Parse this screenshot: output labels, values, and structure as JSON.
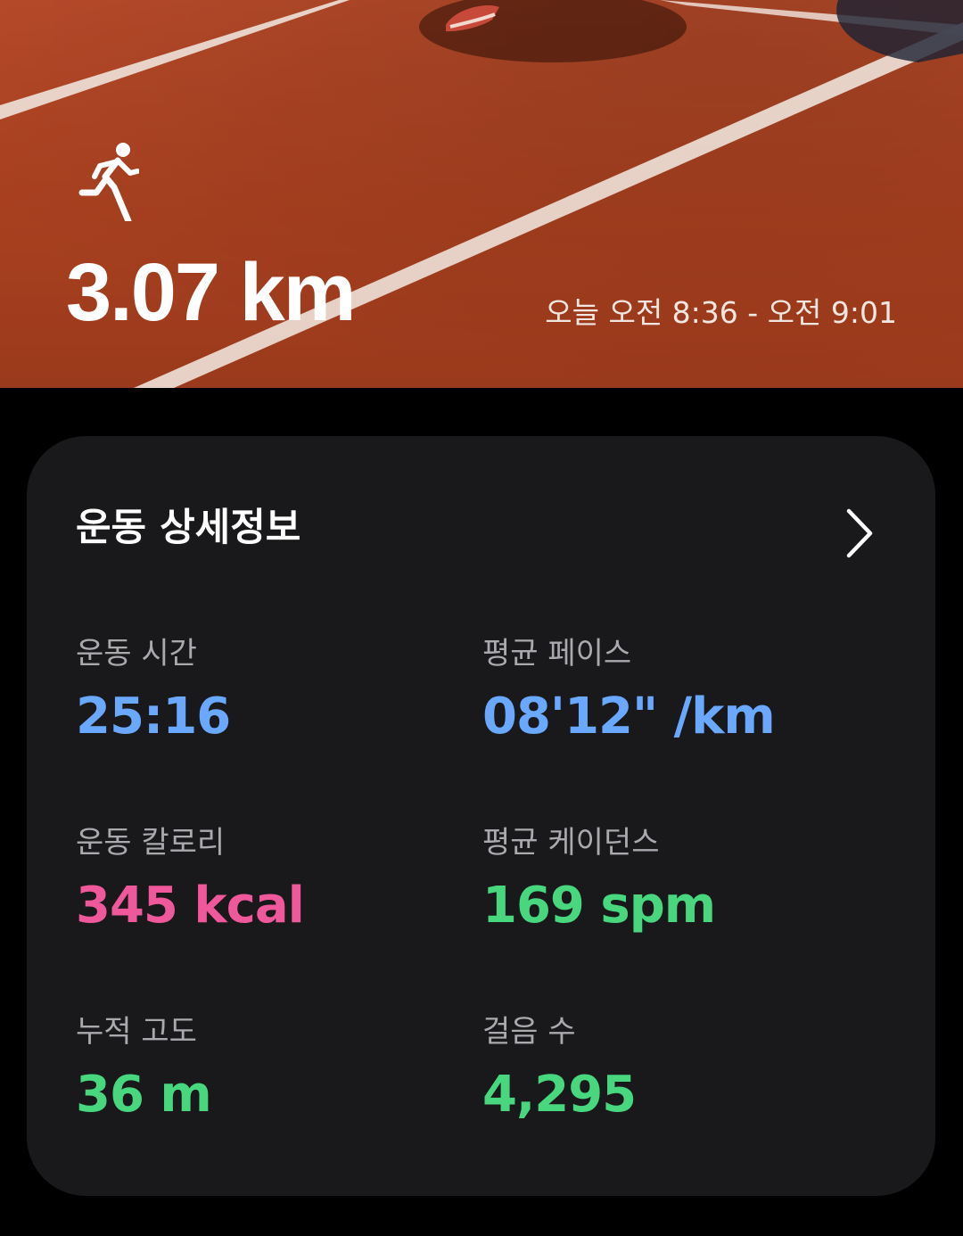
{
  "workout": {
    "distance": "3.07 km",
    "time_range": "오늘 오전 8:36 - 오전 9:01",
    "icon": "running-person-icon"
  },
  "details": {
    "title": "운동 상세정보",
    "more_icon": "chevron-right-icon",
    "stats": [
      {
        "label": "운동 시간",
        "value": "25:16",
        "color": "#6aa8ff"
      },
      {
        "label": "평균 페이스",
        "value": "08'12\" /km",
        "color": "#6aa8ff"
      },
      {
        "label": "운동 칼로리",
        "value": "345 kcal",
        "color": "#f0589c"
      },
      {
        "label": "평균 케이던스",
        "value": "169 spm",
        "color": "#48d67f"
      },
      {
        "label": "누적 고도",
        "value": "36 m",
        "color": "#48d67f"
      },
      {
        "label": "걸음 수",
        "value": "4,295",
        "color": "#48d67f"
      }
    ]
  }
}
